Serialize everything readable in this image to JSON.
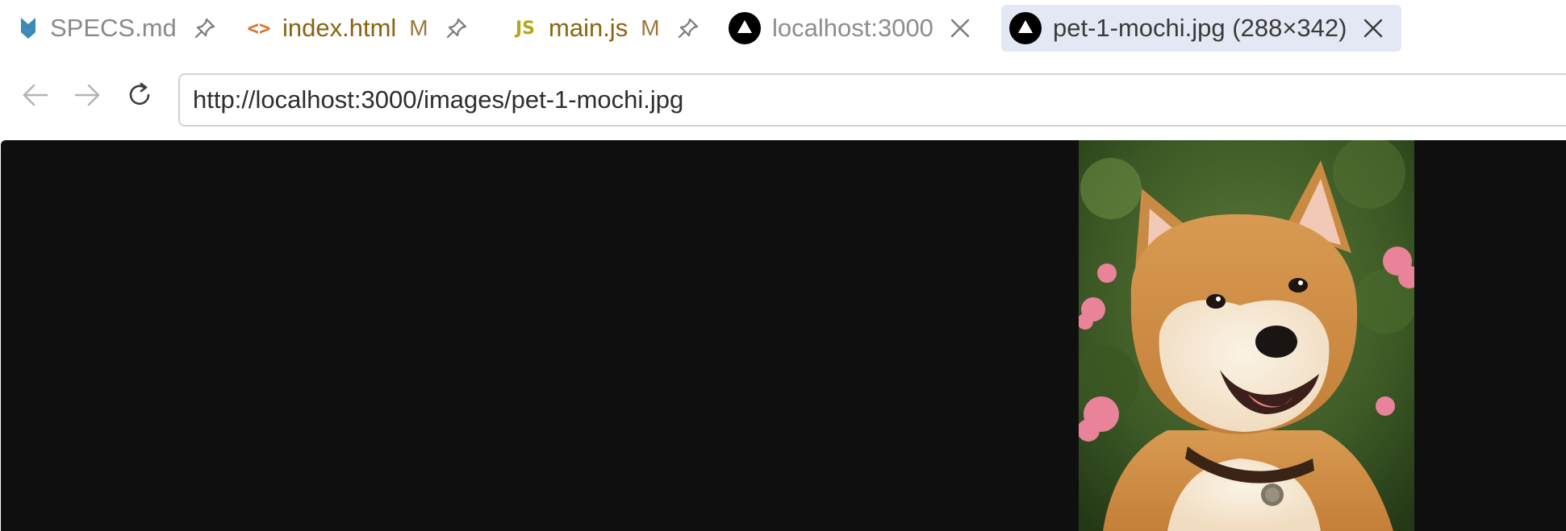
{
  "tabs": [
    {
      "label": "SPECS.md",
      "modified": "",
      "icon": "markdown-download-icon",
      "action": "pin-icon"
    },
    {
      "label": "index.html",
      "modified": "M",
      "icon": "html-code-icon",
      "icon_text": "<>",
      "action": "pin-icon"
    },
    {
      "label": "main.js",
      "modified": "M",
      "icon": "javascript-icon",
      "icon_text": "JS",
      "action": "pin-icon"
    },
    {
      "label": "localhost:3000",
      "modified": "",
      "icon": "browser-triangle-icon",
      "action": "close-icon"
    },
    {
      "label": "pet-1-mochi.jpg (288×342)",
      "modified": "",
      "icon": "browser-triangle-icon",
      "action": "close-icon",
      "active": true
    }
  ],
  "nav": {
    "back_icon": "arrow-left-icon",
    "forward_icon": "arrow-right-icon",
    "reload_icon": "reload-icon"
  },
  "url": "http://localhost:3000/images/pet-1-mochi.jpg",
  "viewer": {
    "image_subject": "shiba inu dog photo",
    "background_color": "#0f0f10"
  },
  "colors": {
    "active_tab_bg": "#e4e8f5",
    "modified_label": "#8a6410",
    "html_icon": "#d9742c",
    "js_icon": "#b8a51a",
    "markdown_icon": "#3b8ab8"
  }
}
